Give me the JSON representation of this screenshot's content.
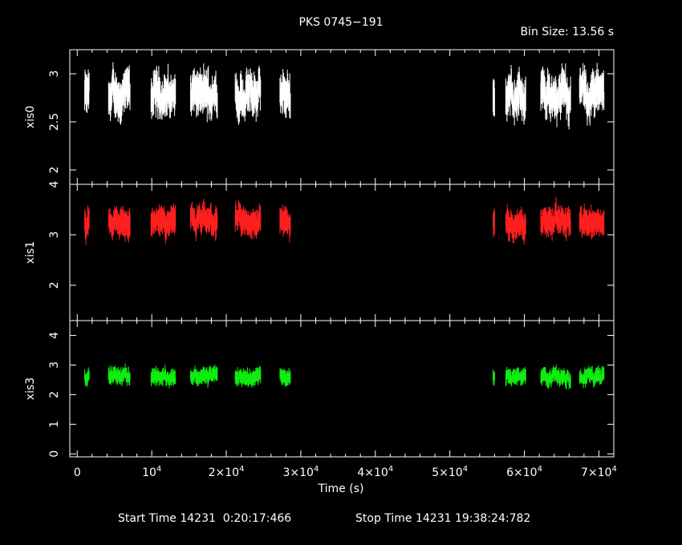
{
  "chart_data": {
    "type": "scatter",
    "title": "PKS 0745−191",
    "bin_size_label": "Bin Size: 13.56 s",
    "xlabel": "Time (s)",
    "xlim": [
      -1000,
      72000
    ],
    "x_ticks": [
      {
        "value": 0,
        "label": "0"
      },
      {
        "value": 10000,
        "label": "10",
        "exp": "4"
      },
      {
        "value": 20000,
        "label": "2×10",
        "exp": "4"
      },
      {
        "value": 30000,
        "label": "3×10",
        "exp": "4"
      },
      {
        "value": 40000,
        "label": "4×10",
        "exp": "4"
      },
      {
        "value": 50000,
        "label": "5×10",
        "exp": "4"
      },
      {
        "value": 60000,
        "label": "6×10",
        "exp": "4"
      },
      {
        "value": 70000,
        "label": "7×10",
        "exp": "4"
      }
    ],
    "gti": [
      [
        1000,
        1600
      ],
      [
        4200,
        7100
      ],
      [
        9900,
        13200
      ],
      [
        15200,
        18800
      ],
      [
        21200,
        24600
      ],
      [
        27200,
        28600
      ],
      [
        55800,
        56000
      ],
      [
        57500,
        60200
      ],
      [
        62200,
        66200
      ],
      [
        67400,
        70700
      ]
    ],
    "panels": [
      {
        "name": "xis0",
        "color": "#ffffff",
        "ylim": [
          1.85,
          3.25
        ],
        "y_ticks": [
          2,
          2.5,
          3
        ],
        "y_tick_labels": [
          "2",
          "2.5",
          "3"
        ],
        "mean": 2.78,
        "spread": 0.13,
        "err": 0.14
      },
      {
        "name": "xis1",
        "color": "#ff2020",
        "ylim": [
          1.3,
          4.0
        ],
        "y_ticks": [
          2,
          3,
          4
        ],
        "y_tick_labels": [
          "2",
          "3",
          "4"
        ],
        "mean": 3.25,
        "spread": 0.16,
        "err": 0.18
      },
      {
        "name": "xis3",
        "color": "#10ee10",
        "ylim": [
          -0.1,
          4.5
        ],
        "y_ticks": [
          0,
          1,
          2,
          3,
          4
        ],
        "y_tick_labels": [
          "0",
          "1",
          "2",
          "3",
          "4"
        ],
        "mean": 2.62,
        "spread": 0.16,
        "err": 0.18
      }
    ]
  },
  "footer": {
    "start_time": "Start Time 14231  0:20:17:466",
    "stop_time": "Stop Time 14231 19:38:24:782"
  }
}
